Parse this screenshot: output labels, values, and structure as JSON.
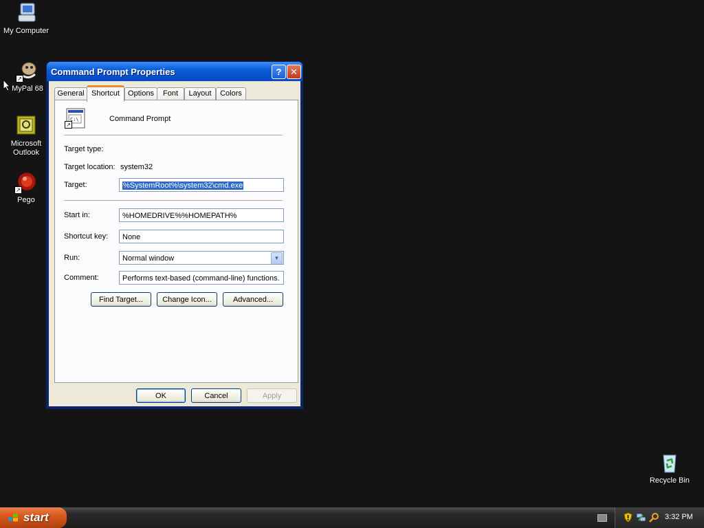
{
  "desktop": {
    "icons": [
      {
        "label": "My Computer",
        "icon": "my-computer-icon"
      },
      {
        "label": "MyPal 68",
        "icon": "mypal-icon"
      },
      {
        "label": "Microsoft\nOutlook",
        "icon": "outlook-icon"
      },
      {
        "label": "Pego",
        "icon": "pego-icon"
      },
      {
        "label": "Recycle Bin",
        "icon": "recycle-bin-icon"
      }
    ]
  },
  "window": {
    "title": "Command Prompt Properties",
    "help_glyph": "?",
    "close_glyph": "✕",
    "tabs": [
      {
        "label": "General"
      },
      {
        "label": "Shortcut",
        "active": true
      },
      {
        "label": "Options"
      },
      {
        "label": "Font"
      },
      {
        "label": "Layout"
      },
      {
        "label": "Colors"
      }
    ],
    "shortcut": {
      "name": "Command Prompt",
      "target_type_label": "Target type:",
      "target_location_label": "Target location:",
      "target_location_value": "system32",
      "target_label": "Target:",
      "target_value": "%SystemRoot%\\system32\\cmd.exe",
      "start_in_label": "Start in:",
      "start_in_value": "%HOMEDRIVE%%HOMEPATH%",
      "shortcut_key_label": "Shortcut key:",
      "shortcut_key_value": "None",
      "run_label": "Run:",
      "run_value": "Normal window",
      "comment_label": "Comment:",
      "comment_value": "Performs text-based (command-line) functions.",
      "find_target_label": "Find Target...",
      "change_icon_label": "Change Icon...",
      "advanced_label": "Advanced..."
    },
    "buttons": {
      "ok": "OK",
      "cancel": "Cancel",
      "apply": "Apply"
    }
  },
  "taskbar": {
    "start_label": "start",
    "clock": "3:32 PM"
  },
  "colors": {
    "accent_tab": "#e68b2c",
    "title_bar": "#0a5fd8",
    "selection": "#316ac5",
    "start_button": "#d8591d"
  }
}
